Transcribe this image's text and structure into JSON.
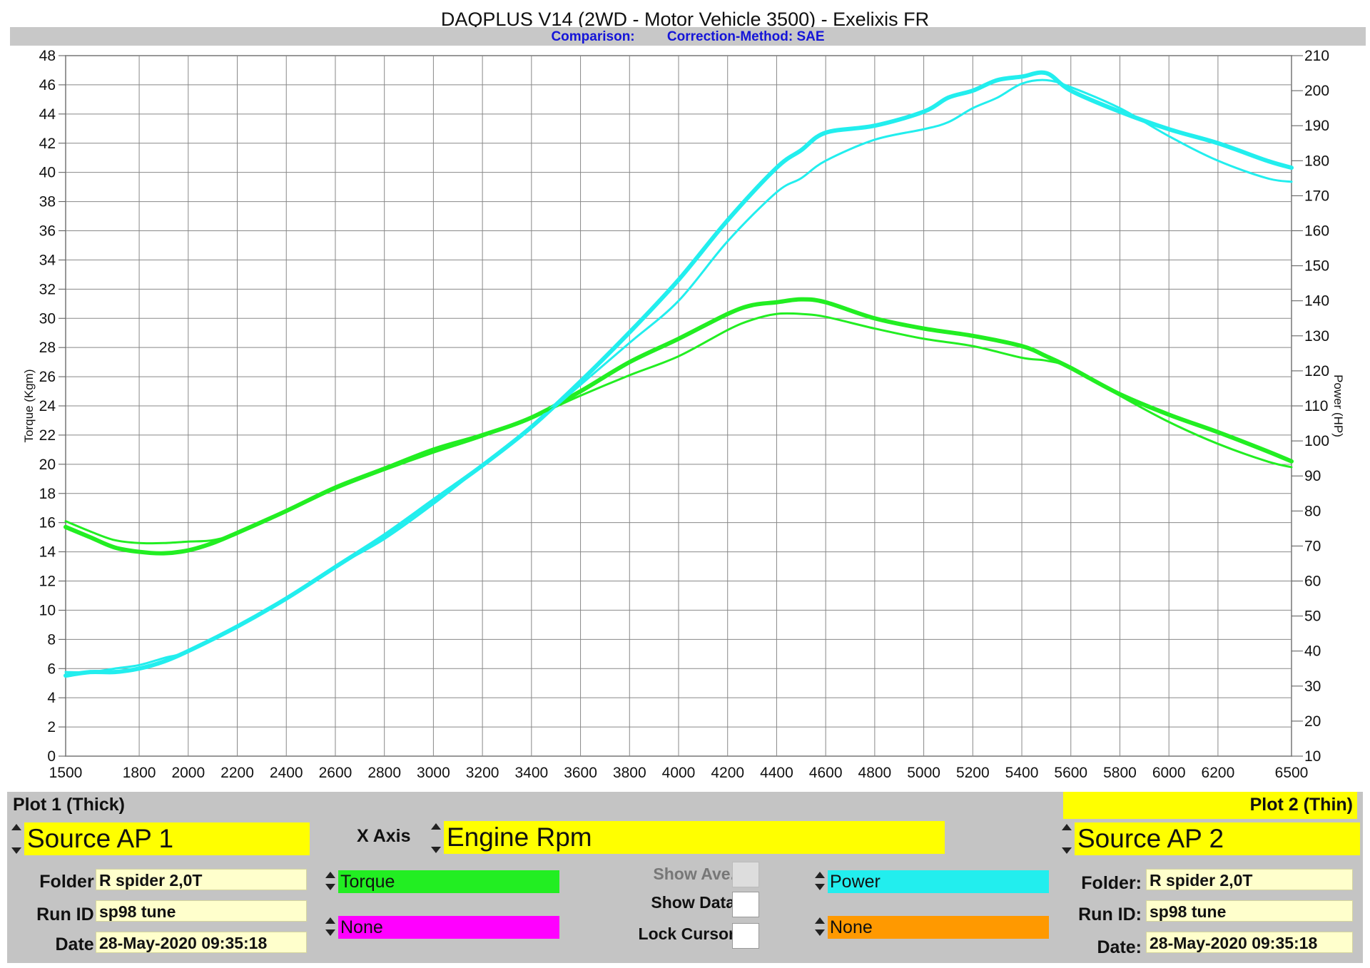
{
  "header": {
    "title": "DAQPLUS V14 (2WD - Motor Vehicle 3500) - Exelixis FR",
    "comparison_label": "Comparison:",
    "correction_label": "Correction-Method: SAE"
  },
  "colors": {
    "torque": "#22ee22",
    "power": "#22eeee",
    "none_left": "#ff00ff",
    "none_right": "#ff9900",
    "highlight": "#ffff00"
  },
  "chart_data": {
    "type": "line",
    "ylabel": "Torque (Kgm)",
    "y2label": "Power (HP)",
    "xlim": [
      1500,
      6500
    ],
    "ylim": [
      0,
      48
    ],
    "y2lim": [
      10,
      210
    ],
    "x_ticks": [
      1500,
      1800,
      2000,
      2200,
      2400,
      2600,
      2800,
      3000,
      3200,
      3400,
      3600,
      3800,
      4000,
      4200,
      4400,
      4600,
      4800,
      5000,
      5200,
      5400,
      5600,
      5800,
      6000,
      6200,
      6500
    ],
    "y_ticks": [
      0,
      2,
      4,
      6,
      8,
      10,
      12,
      14,
      16,
      18,
      20,
      22,
      24,
      26,
      28,
      30,
      32,
      34,
      36,
      38,
      40,
      42,
      44,
      46,
      48
    ],
    "y2_ticks": [
      10,
      20,
      30,
      40,
      50,
      60,
      70,
      80,
      90,
      100,
      110,
      120,
      130,
      140,
      150,
      160,
      170,
      180,
      190,
      200,
      210
    ],
    "grid": true,
    "series": [
      {
        "name": "Torque",
        "plot": "Plot 1 (Thick)",
        "axis": "left",
        "x": [
          1500,
          1600,
          1700,
          1800,
          1900,
          2000,
          2100,
          2200,
          2400,
          2600,
          2800,
          3000,
          3200,
          3400,
          3600,
          3800,
          4000,
          4200,
          4300,
          4400,
          4500,
          4600,
          4800,
          5000,
          5200,
          5400,
          5500,
          5600,
          5800,
          6000,
          6200,
          6400,
          6500
        ],
        "y": [
          15.7,
          15.0,
          14.3,
          14.0,
          13.9,
          14.1,
          14.6,
          15.3,
          16.8,
          18.4,
          19.7,
          21.0,
          22.0,
          23.2,
          25.0,
          27.0,
          28.6,
          30.3,
          30.9,
          31.1,
          31.3,
          31.1,
          30.0,
          29.3,
          28.8,
          28.1,
          27.4,
          26.6,
          24.8,
          23.4,
          22.2,
          20.9,
          20.2
        ]
      },
      {
        "name": "Power",
        "plot": "Plot 1 (Thick)",
        "axis": "right",
        "x": [
          1500,
          1600,
          1700,
          1800,
          1900,
          2000,
          2200,
          2400,
          2600,
          2800,
          3000,
          3200,
          3400,
          3600,
          3800,
          4000,
          4200,
          4400,
          4500,
          4600,
          4800,
          5000,
          5100,
          5200,
          5300,
          5400,
          5500,
          5600,
          5800,
          6000,
          6200,
          6400,
          6500
        ],
        "y": [
          33,
          34,
          34,
          35,
          37,
          40,
          47,
          55,
          64,
          73,
          83,
          93,
          104,
          117,
          131,
          146,
          163,
          178,
          183,
          188,
          190,
          194,
          198,
          200,
          203,
          204,
          205,
          200,
          194,
          189,
          185,
          180,
          178
        ]
      },
      {
        "name": "Torque",
        "plot": "Plot 2 (Thin)",
        "axis": "left",
        "x": [
          1500,
          1600,
          1700,
          1800,
          1900,
          2000,
          2100,
          2200,
          2400,
          2600,
          2800,
          3000,
          3200,
          3400,
          3600,
          3800,
          4000,
          4200,
          4300,
          4400,
          4500,
          4600,
          4800,
          5000,
          5200,
          5400,
          5500,
          5600,
          5800,
          6000,
          6200,
          6400,
          6500
        ],
        "y": [
          16.1,
          15.4,
          14.8,
          14.6,
          14.6,
          14.7,
          14.8,
          15.3,
          16.8,
          18.3,
          19.6,
          20.8,
          21.9,
          23.2,
          24.7,
          26.1,
          27.4,
          29.2,
          29.9,
          30.3,
          30.3,
          30.1,
          29.3,
          28.6,
          28.1,
          27.3,
          27.1,
          26.6,
          24.7,
          22.9,
          21.4,
          20.2,
          19.8
        ]
      },
      {
        "name": "Power",
        "plot": "Plot 2 (Thin)",
        "axis": "right",
        "x": [
          1500,
          1600,
          1700,
          1800,
          1900,
          2000,
          2200,
          2400,
          2600,
          2800,
          3000,
          3200,
          3400,
          3600,
          3800,
          4000,
          4200,
          4400,
          4500,
          4600,
          4800,
          5000,
          5100,
          5200,
          5300,
          5400,
          5500,
          5600,
          5800,
          6000,
          6200,
          6400,
          6500
        ],
        "y": [
          34,
          34,
          35,
          36,
          38,
          40,
          47,
          55,
          64,
          72,
          82,
          93,
          104,
          116,
          128,
          140,
          157,
          171,
          175,
          180,
          186,
          189,
          191,
          195,
          198,
          202,
          203,
          201,
          195,
          187,
          180,
          175,
          174
        ]
      }
    ]
  },
  "panel": {
    "plot1_label": "Plot 1 (Thick)",
    "plot2_label": "Plot 2 (Thin)",
    "source1": "Source AP 1",
    "source2": "Source AP 2",
    "xaxis_label": "X Axis",
    "xaxis_value": "Engine Rpm",
    "folder_label": "Folder:",
    "runid_label": "Run ID:",
    "date_label": "Date:",
    "left": {
      "folder": "R spider 2,0T",
      "run_id": "sp98 tune",
      "date": "28-May-2020 09:35:18"
    },
    "right": {
      "folder": "R spider 2,0T",
      "run_id": "sp98 tune",
      "date": "28-May-2020 09:35:18"
    },
    "channel1": "Torque",
    "channel2": "None",
    "channel3": "Power",
    "channel4": "None",
    "show_ave": "Show Ave.",
    "show_data": "Show Data",
    "lock_cursor": "Lock Cursor"
  }
}
